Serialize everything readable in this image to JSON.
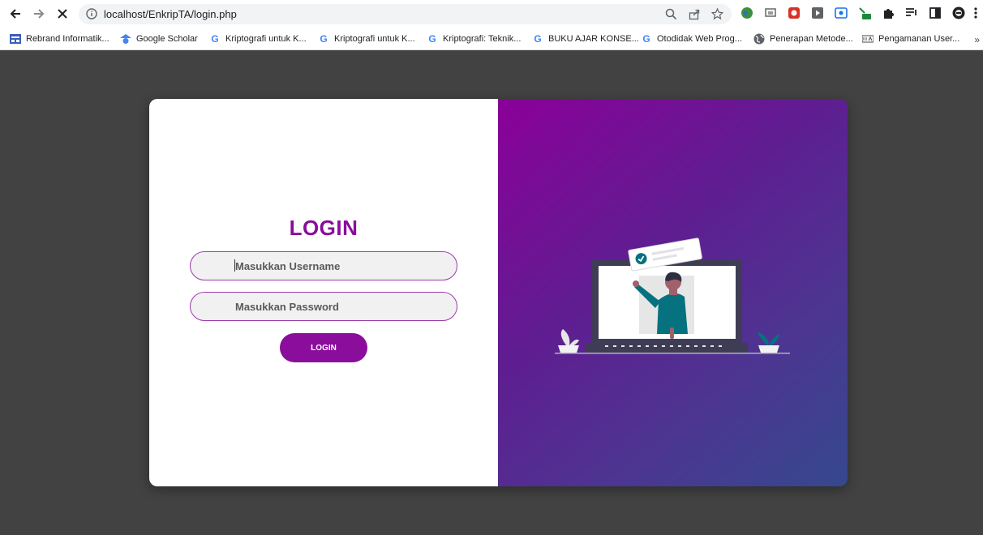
{
  "browser": {
    "url": "localhost/EnkripTA/login.php",
    "bookmarks": [
      {
        "label": "Rebrand Informatik...",
        "icon": "grid-icon"
      },
      {
        "label": "Google Scholar",
        "icon": "scholar-icon"
      },
      {
        "label": "Kriptografi untuk K...",
        "icon": "google-icon"
      },
      {
        "label": "Kriptografi untuk K...",
        "icon": "google-icon"
      },
      {
        "label": "Kriptografi: Teknik...",
        "icon": "google-icon"
      },
      {
        "label": "BUKU AJAR KONSE...",
        "icon": "google-icon"
      },
      {
        "label": "Otodidak Web Prog...",
        "icon": "google-icon"
      },
      {
        "label": "Penerapan Metode...",
        "icon": "globe-icon"
      },
      {
        "label": "Pengamanan User...",
        "icon": "site-icon"
      }
    ],
    "bookmarks_more": "»"
  },
  "login": {
    "title": "LOGIN",
    "username_placeholder": "Masukkan Username",
    "password_placeholder": "Masukkan Password",
    "button_label": "LOGIN"
  },
  "colors": {
    "accent": "#8a0d9b",
    "page_background": "#424242",
    "gradient_start": "#8b0099",
    "gradient_end": "#35488e"
  }
}
